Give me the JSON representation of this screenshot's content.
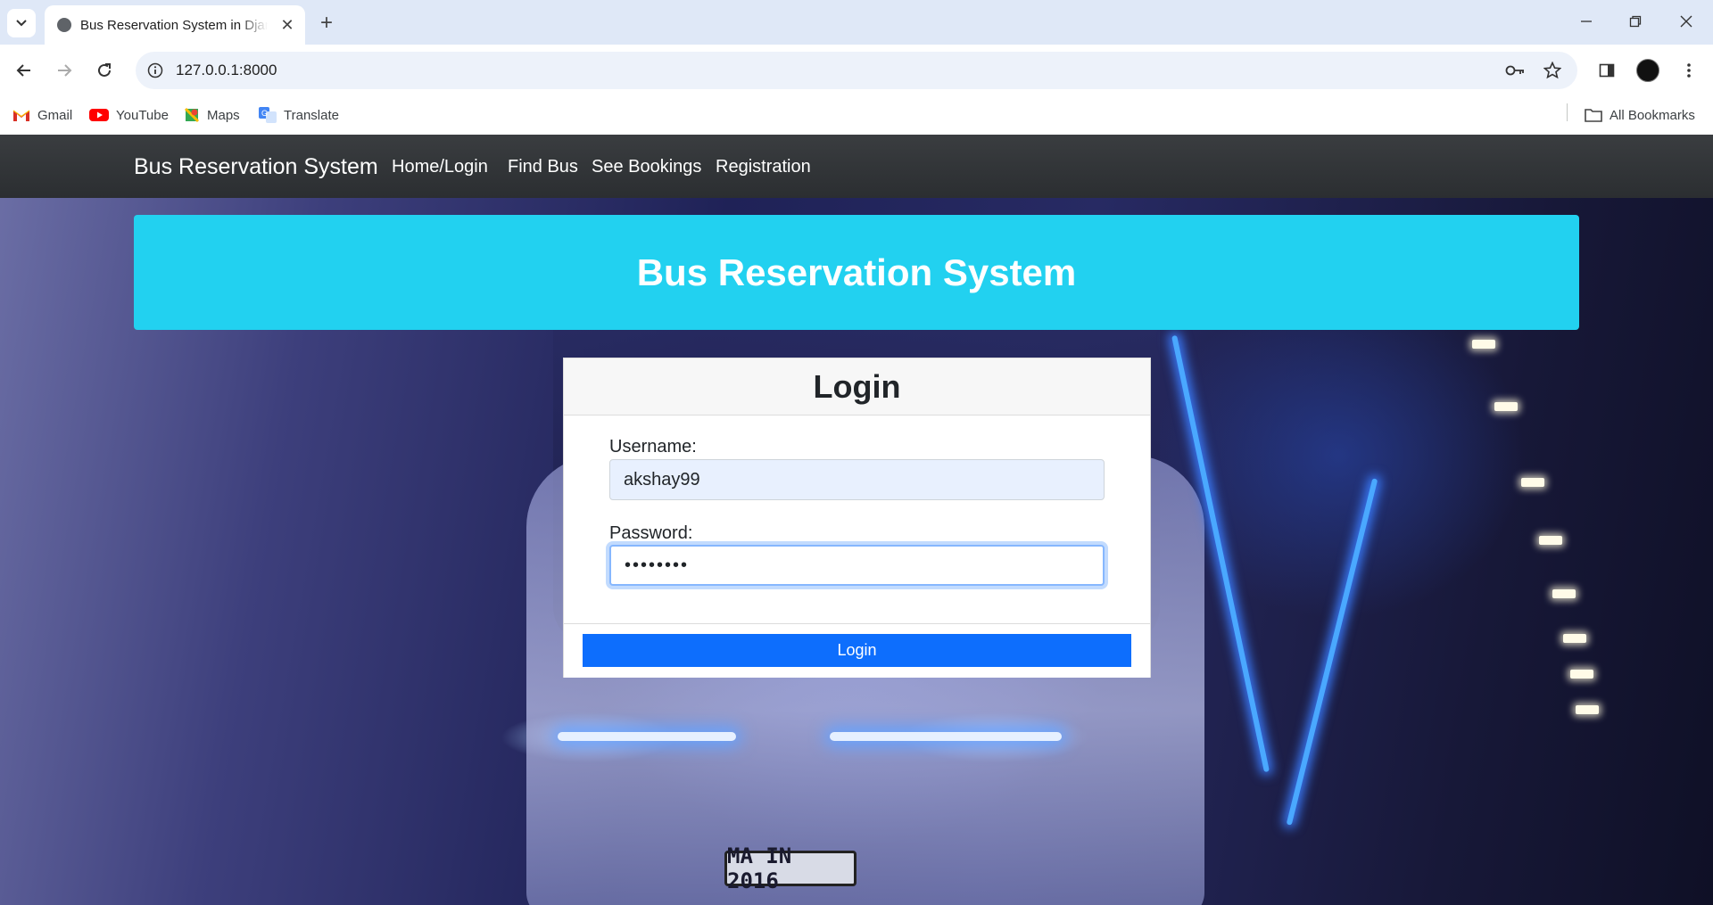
{
  "browser": {
    "tab_title": "Bus Reservation System in Django",
    "url": "127.0.0.1:8000",
    "bookmarks": [
      "Gmail",
      "YouTube",
      "Maps",
      "Translate"
    ],
    "all_bookmarks": "All Bookmarks"
  },
  "navbar": {
    "brand": "Bus Reservation System",
    "links": [
      "Home/Login",
      "Find Bus",
      "See Bookings",
      "Registration"
    ]
  },
  "banner": {
    "title": "Bus Reservation System"
  },
  "login": {
    "title": "Login",
    "username_label": "Username:",
    "username_value": "akshay99",
    "password_label": "Password:",
    "password_value": "••••••••",
    "submit_label": "Login"
  },
  "background": {
    "plate_text": "MA IN 2016"
  },
  "colors": {
    "accent": "#0d6efd",
    "banner": "#22d1f0",
    "navbar": "#343a40"
  }
}
